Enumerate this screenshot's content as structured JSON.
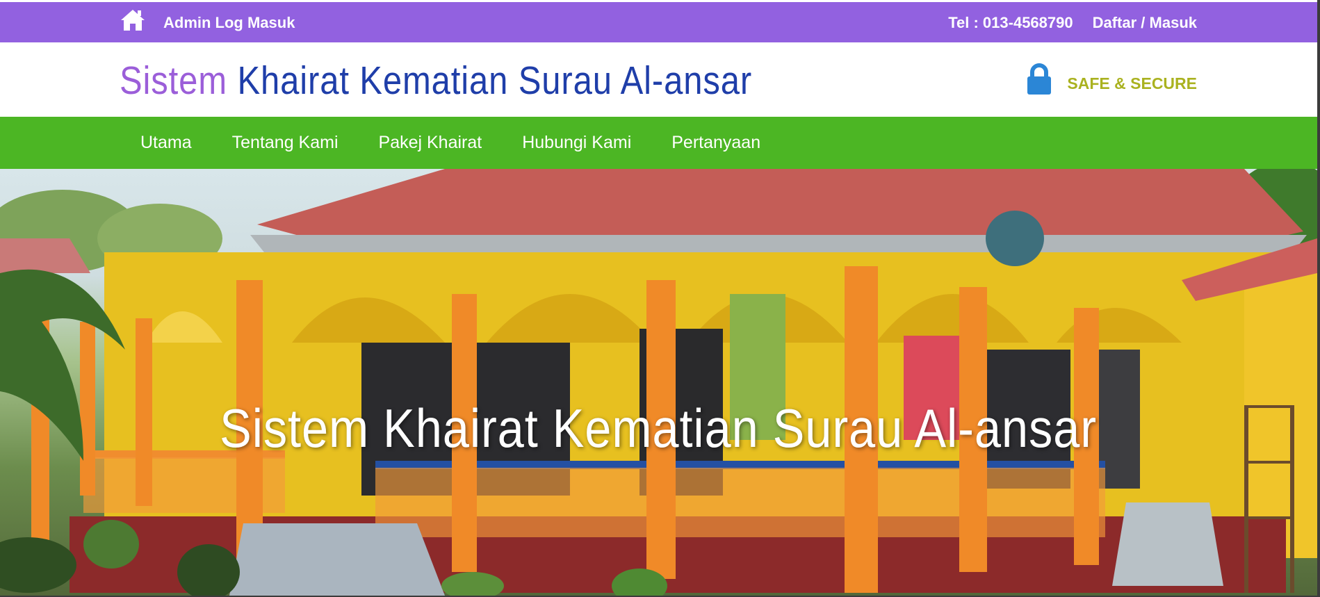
{
  "topbar": {
    "home_icon": "home-icon",
    "admin_login": "Admin Log Masuk",
    "phone": "Tel : 013-4568790",
    "register_login": "Daftar / Masuk"
  },
  "brand": {
    "word1": "Sistem",
    "word2": "Khairat Kematian Surau Al-ansar",
    "secure_icon": "lock-icon",
    "secure_label": "SAFE & SECURE"
  },
  "nav": {
    "items": [
      "Utama",
      "Tentang Kami",
      "Pakej Khairat",
      "Hubungi Kami",
      "Pertanyaan"
    ]
  },
  "hero": {
    "title": "Sistem Khairat Kematian Surau Al-ansar"
  },
  "colors": {
    "topbar": "#9261e0",
    "brand_purple": "#9b5ed9",
    "brand_blue": "#1f3ea9",
    "secure": "#aab220",
    "lock": "#2b86d6",
    "nav": "#4cb624"
  }
}
